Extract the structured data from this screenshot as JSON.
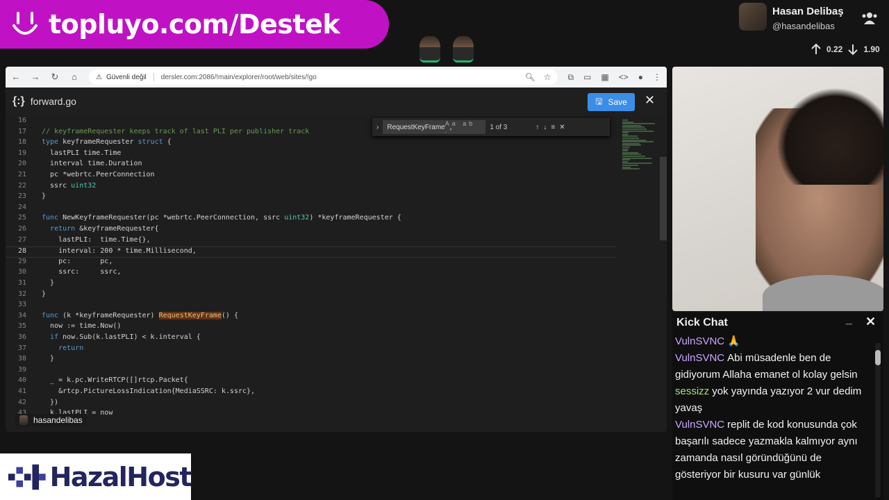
{
  "banner": {
    "text": "topluyo.com/Destek"
  },
  "profile": {
    "name": "Hasan Delibaş",
    "handle": "@hasandelibas"
  },
  "network": {
    "up": "0.22",
    "down": "1.90"
  },
  "browser": {
    "security_label": "Güvenli değil",
    "url": "dersler.com:2086/!main/explorer/root/web/sites/!go"
  },
  "editor": {
    "filename": "forward.go",
    "save_label": "Save",
    "find": {
      "query": "RequestKeyFrame",
      "count": "1 of 3"
    },
    "lines": [
      {
        "n": "16",
        "html": ""
      },
      {
        "n": "17",
        "html": "<span class='cm'>// keyframeRequester keeps track of last PLI per publisher track</span>"
      },
      {
        "n": "18",
        "html": "<span class='kw'>type</span> keyframeRequester <span class='kw'>struct</span> {"
      },
      {
        "n": "19",
        "html": "  lastPLI time.Time"
      },
      {
        "n": "20",
        "html": "  interval time.Duration"
      },
      {
        "n": "21",
        "html": "  pc *webrtc.PeerConnection"
      },
      {
        "n": "22",
        "html": "  ssrc <span class='ty'>uint32</span>"
      },
      {
        "n": "23",
        "html": "}"
      },
      {
        "n": "24",
        "html": ""
      },
      {
        "n": "25",
        "html": "<span class='kw'>func</span> NewKeyframeRequester(pc *webrtc.PeerConnection, ssrc <span class='ty'>uint32</span>) *keyframeRequester {"
      },
      {
        "n": "26",
        "html": "  <span class='kw'>return</span> &amp;keyframeRequester{"
      },
      {
        "n": "27",
        "html": "    lastPLI:  time.Time{},"
      },
      {
        "n": "28",
        "html": "    interval: 200 * time.Millisecond,"
      },
      {
        "n": "29",
        "html": "    pc:       pc,"
      },
      {
        "n": "30",
        "html": "    ssrc:     ssrc,"
      },
      {
        "n": "31",
        "html": "  }"
      },
      {
        "n": "32",
        "html": "}"
      },
      {
        "n": "33",
        "html": ""
      },
      {
        "n": "34",
        "html": "<span class='kw'>func</span> (k *keyframeRequester) <span class='hl'>RequestKeyFrame</span>() {"
      },
      {
        "n": "35",
        "html": "  now := time.Now()"
      },
      {
        "n": "36",
        "html": "  <span class='kw'>if</span> now.Sub(k.lastPLI) &lt; k.interval {"
      },
      {
        "n": "37",
        "html": "    <span class='kw'>return</span>"
      },
      {
        "n": "38",
        "html": "  }"
      },
      {
        "n": "39",
        "html": ""
      },
      {
        "n": "40",
        "html": "  _ = k.pc.WriteRTCP([]rtcp.Packet{"
      },
      {
        "n": "41",
        "html": "    &amp;rtcp.PictureLossIndication{MediaSSRC: k.ssrc},"
      },
      {
        "n": "42",
        "html": "  })"
      },
      {
        "n": "43",
        "html": "  k.lastPLI = now"
      }
    ]
  },
  "owner_tag": {
    "name": "hasandelibas"
  },
  "chat": {
    "title": "Kick Chat",
    "messages": [
      {
        "user": "VulnSVNC",
        "color": "#c9a6ff",
        "text": "🙏"
      },
      {
        "user": "VulnSVNC",
        "color": "#c9a6ff",
        "text": "Abi müsadenle ben de gidiyorum Allaha emanet ol kolay gelsin"
      },
      {
        "user": "sessizz",
        "color": "#a6e07a",
        "text": "yok yayında yazıyor 2 vur dedim yavaş"
      },
      {
        "user": "VulnSVNC",
        "color": "#c9a6ff",
        "text": "replit de kod konusunda çok başarılı sadece yazmakla kalmıyor aynı zamanda nasıl göründüğünü de gösteriyor bir kusuru var günlük"
      }
    ]
  },
  "sponsor": {
    "name": "HazalHost"
  },
  "colors": {
    "banner": "#c012c4",
    "save": "#3b8ee8",
    "sponsor_text": "#23255e"
  }
}
